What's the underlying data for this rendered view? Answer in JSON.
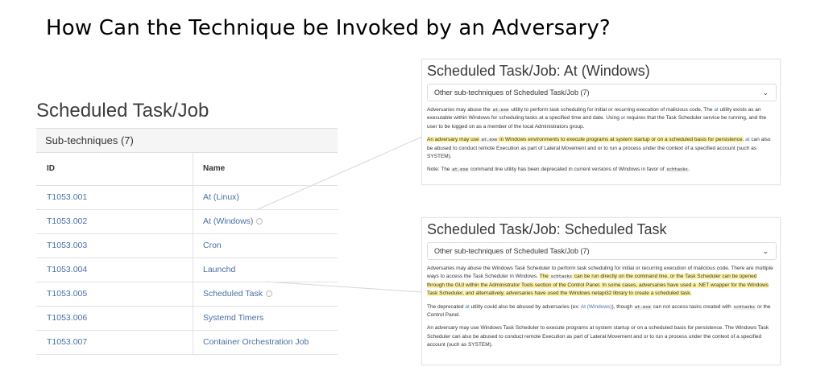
{
  "slide": {
    "title": "How Can the Technique be Invoked by an Adversary?"
  },
  "left": {
    "heading": "Scheduled Task/Job",
    "table_header": "Sub-techniques (7)",
    "columns": [
      "ID",
      "Name"
    ],
    "rows": [
      {
        "id": "T1053.001",
        "name": "At (Linux)"
      },
      {
        "id": "T1053.002",
        "name": "At (Windows)"
      },
      {
        "id": "T1053.003",
        "name": "Cron"
      },
      {
        "id": "T1053.004",
        "name": "Launchd"
      },
      {
        "id": "T1053.005",
        "name": "Scheduled Task"
      },
      {
        "id": "T1053.006",
        "name": "Systemd Timers"
      },
      {
        "id": "T1053.007",
        "name": "Container Orchestration Job"
      }
    ]
  },
  "panel_at": {
    "title": "Scheduled Task/Job: At (Windows)",
    "dropdown": "Other sub-techniques of Scheduled Task/Job (7)",
    "p1": {
      "a": "Adversaries may abuse the ",
      "code1": "at.exe",
      "b": " utility to perform task scheduling for initial or recurring execution of malicious code. The ",
      "link1": "at",
      "c": " utility exists as an executable within Windows for scheduling tasks at a specified time and date. Using ",
      "link2": "at",
      "d": " requires that the Task Scheduler service be running, and the user to be logged on as a member of the local Administrators group."
    },
    "p2": {
      "a": "An adversary may use ",
      "code1": "at.exe",
      "b": " in Windows environments to execute programs at system startup or on a scheduled basis for persistence.",
      "link1": "at",
      "c": " can also be abused to conduct remote Execution as part of Lateral Movement and or to run a process under the context of a specified account (such as SYSTEM)."
    },
    "p3": {
      "a": "Note: The ",
      "code1": "at.exe",
      "b": " command line utility has been deprecated in current versions of Windows in favor of ",
      "code2": "schtasks",
      "c": "."
    }
  },
  "panel_sched": {
    "title": "Scheduled Task/Job: Scheduled Task",
    "dropdown": "Other sub-techniques of Scheduled Task/Job (7)",
    "p1": {
      "a": "Adversaries may abuse the Windows Task Scheduler to perform task scheduling for initial or recurring execution of malicious code. There are multiple ways to access the Task Scheduler in Windows. ",
      "h1": "The ",
      "code1": "schtasks",
      "h2": " can be run directly on the command line, or the Task Scheduler can be opened through the GUI within the Administrator Tools section of the Control Panel. In some cases, adversaries have used a .NET wrapper for the Windows Task Scheduler, and alternatively, adversaries have used the Windows netapi32 library to create a scheduled task."
    },
    "p2": {
      "a": "The deprecated ",
      "link1": "at",
      "b": " utility could also be abused by adversaries (ex: ",
      "link2": "At (Windows)",
      "c": "), though ",
      "code1": "at.exe",
      "d": " can not access tasks created with ",
      "code2": "schtasks",
      "e": " or the Control Panel."
    },
    "p3": "An adversary may use Windows Task Scheduler to execute programs at system startup or on a scheduled basis for persistence. The Windows Task Scheduler can also be abused to conduct remote Execution as part of Lateral Movement and or to run a process under the context of a specified account (such as SYSTEM)."
  },
  "icons": {
    "dropdown_chevron": "chevron-down-icon",
    "link_marker": "link-icon"
  },
  "colors": {
    "link": "#4a6fa5",
    "highlight": "#fff3a6"
  }
}
